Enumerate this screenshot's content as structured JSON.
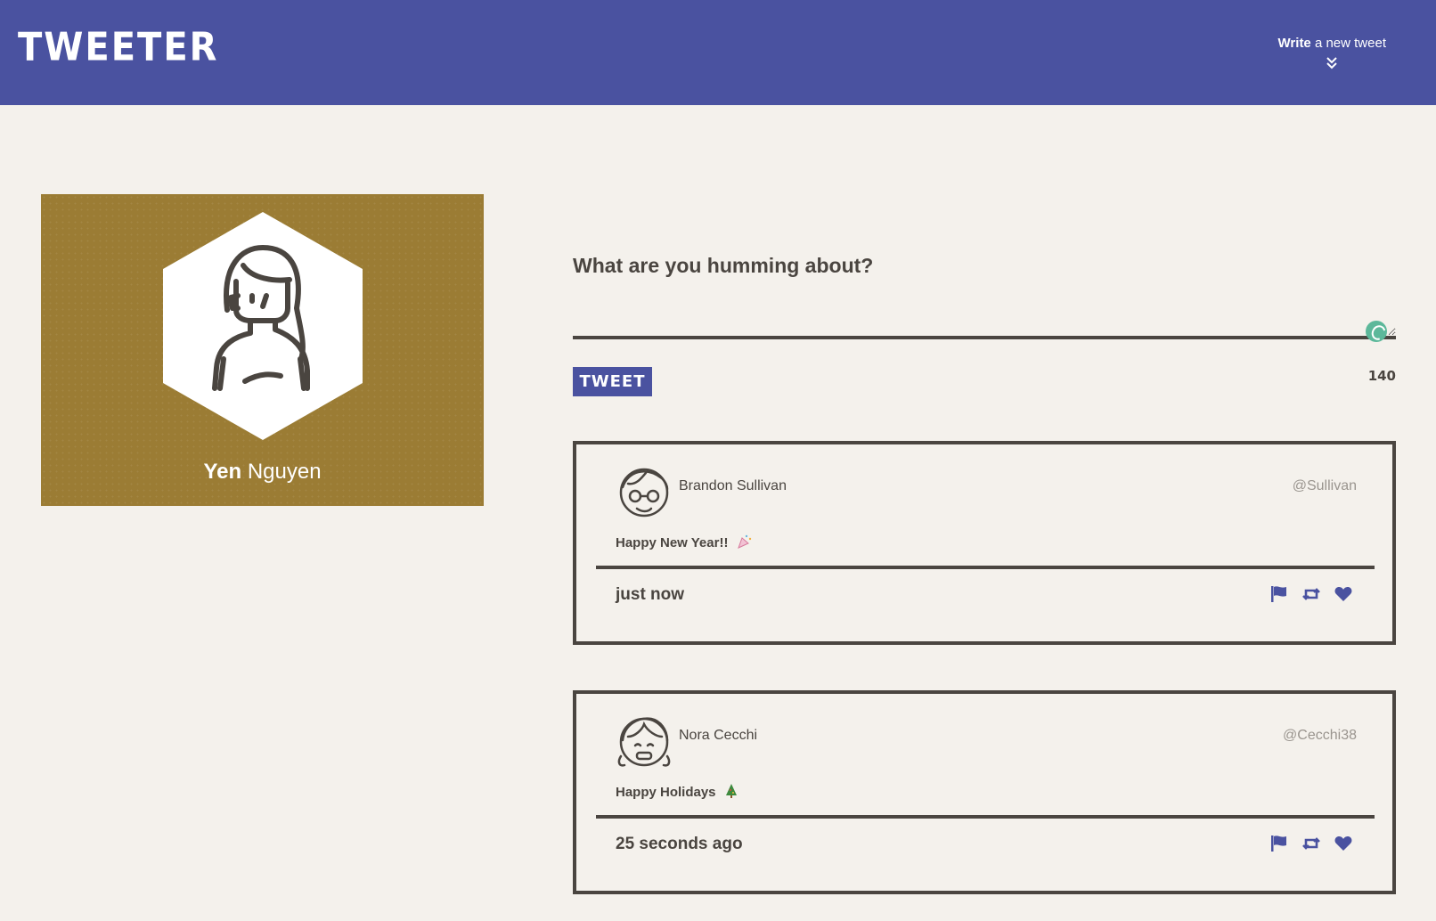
{
  "nav": {
    "logo": "TWEETER",
    "compose_bold": "Write",
    "compose_rest": " a new tweet"
  },
  "profile": {
    "first_name": "Yen",
    "last_name": "Nguyen"
  },
  "composer": {
    "label": "What are you humming about?",
    "button": "TWEET",
    "counter": "140"
  },
  "tweets": [
    {
      "author": "Brandon Sullivan",
      "handle": "@Sullivan",
      "text": "Happy New Year!!",
      "time": "just now",
      "emoji": "party-popper-icon"
    },
    {
      "author": "Nora Cecchi",
      "handle": "@Cecchi38",
      "text": "Happy Holidays",
      "time": "25 seconds ago",
      "emoji": "christmas-tree-icon"
    }
  ],
  "colors": {
    "nav": "#4a52a0",
    "profile_bg": "#9b7c34",
    "accent": "#4a52a0",
    "text": "#4a4540",
    "spinner": "#5cb89a"
  }
}
